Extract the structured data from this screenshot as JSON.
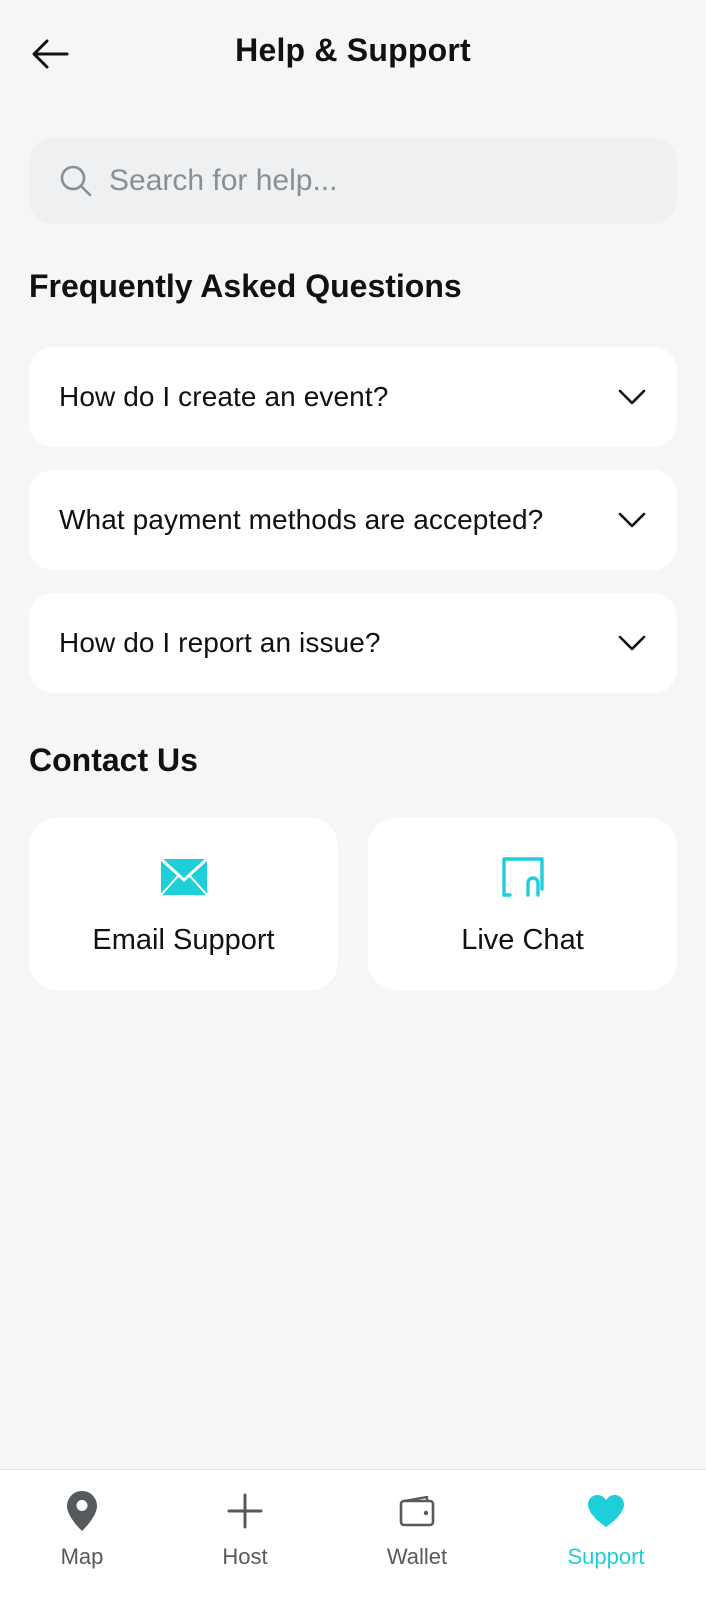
{
  "header": {
    "title": "Help & Support"
  },
  "search": {
    "placeholder": "Search for help..."
  },
  "faq": {
    "title": "Frequently Asked Questions",
    "items": [
      {
        "question": "How do I create an event?"
      },
      {
        "question": "What payment methods are accepted?"
      },
      {
        "question": "How do I report an issue?"
      }
    ]
  },
  "contact": {
    "title": "Contact Us",
    "cards": [
      {
        "label": "Email Support",
        "icon": "mail-icon"
      },
      {
        "label": "Live Chat",
        "icon": "chat-icon"
      }
    ]
  },
  "nav": {
    "items": [
      {
        "label": "Map",
        "icon": "map-pin-icon",
        "active": false
      },
      {
        "label": "Host",
        "icon": "plus-icon",
        "active": false
      },
      {
        "label": "Wallet",
        "icon": "wallet-icon",
        "active": false
      },
      {
        "label": "Support",
        "icon": "heart-icon",
        "active": true
      }
    ]
  },
  "colors": {
    "accent": "#1ecfd9",
    "background": "#f5f6f6",
    "card": "#ffffff",
    "search_bg": "#eef0f1"
  }
}
